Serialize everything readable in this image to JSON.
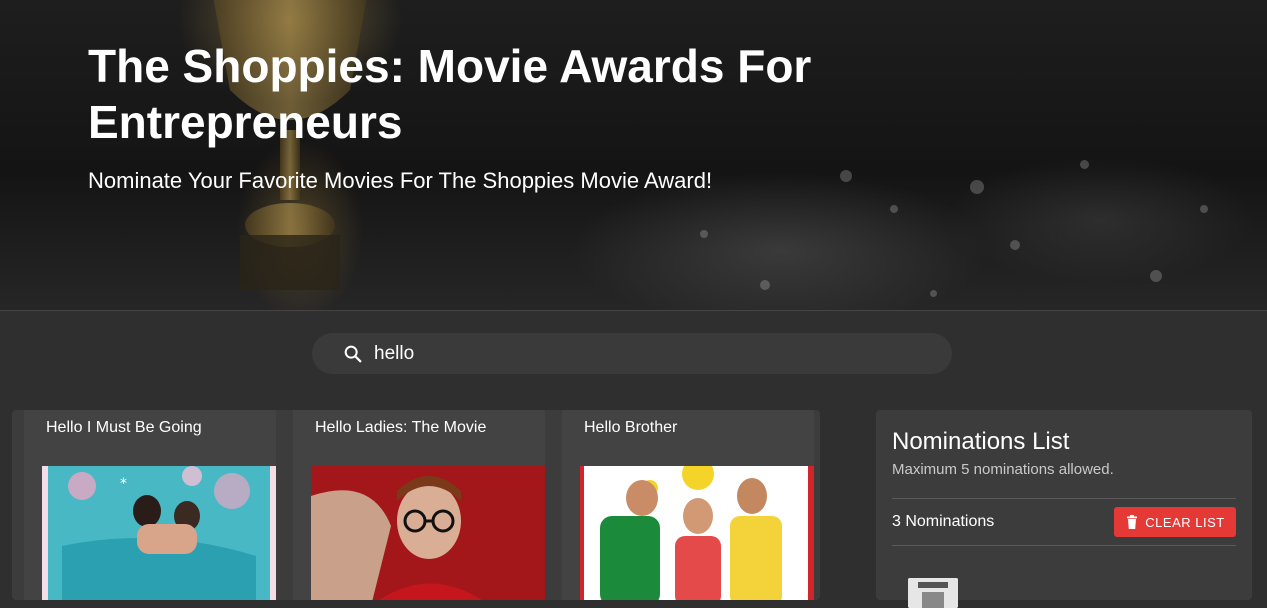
{
  "hero": {
    "title": "The Shoppies: Movie Awards For Entrepreneurs",
    "subtitle": "Nominate Your Favorite Movies For The Shoppies Movie Award!"
  },
  "search": {
    "icon": "search-icon",
    "value": "hello"
  },
  "results": [
    {
      "title": "Hello I Must Be Going"
    },
    {
      "title": "Hello Ladies: The Movie"
    },
    {
      "title": "Hello Brother"
    }
  ],
  "nominations": {
    "title": "Nominations List",
    "subtitle": "Maximum 5 nominations allowed.",
    "count_label": "3 Nominations",
    "clear_label": "CLEAR LIST",
    "clear_icon": "trash-icon",
    "accent_color": "#e53935"
  }
}
